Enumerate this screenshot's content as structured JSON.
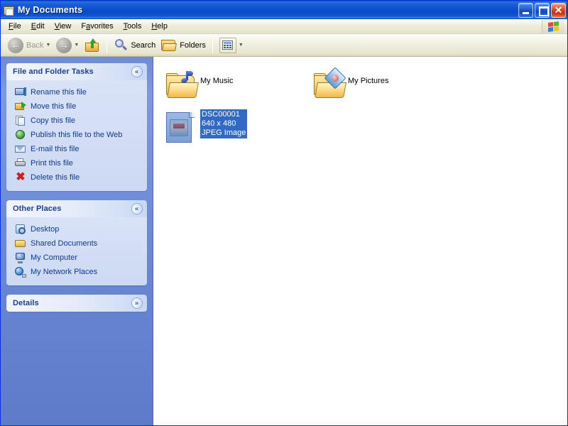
{
  "window": {
    "title": "My Documents",
    "title_icon": "documents-folder-icon",
    "minimize_label": "Minimize",
    "maximize_label": "Maximize",
    "close_label": "✕"
  },
  "menubar": {
    "items": [
      {
        "label": "File",
        "accel": "F"
      },
      {
        "label": "Edit",
        "accel": "E"
      },
      {
        "label": "View",
        "accel": "V"
      },
      {
        "label": "Favorites",
        "accel": "a"
      },
      {
        "label": "Tools",
        "accel": "T"
      },
      {
        "label": "Help",
        "accel": "H"
      }
    ],
    "brand_icon": "windows-flag-icon"
  },
  "toolbar": {
    "back_label": "Back",
    "back_icon": "arrow-left-icon",
    "back_disabled": true,
    "forward_icon": "arrow-right-icon",
    "up_icon": "folder-up-icon",
    "search_label": "Search",
    "search_icon": "magnifier-icon",
    "folders_label": "Folders",
    "folders_icon": "folder-icon",
    "views_icon": "views-grid-icon",
    "caret": "▼"
  },
  "sidebar": {
    "panels": [
      {
        "title": "File and Folder Tasks",
        "chevron": "«",
        "chevron_state": "collapse",
        "items": [
          {
            "label": "Rename this file",
            "icon": "rename-icon"
          },
          {
            "label": "Move this file",
            "icon": "move-icon"
          },
          {
            "label": "Copy this file",
            "icon": "copy-icon"
          },
          {
            "label": "Publish this file to the Web",
            "icon": "publish-web-icon"
          },
          {
            "label": "E-mail this file",
            "icon": "email-icon"
          },
          {
            "label": "Print this file",
            "icon": "print-icon"
          },
          {
            "label": "Delete this file",
            "icon": "delete-icon"
          }
        ]
      },
      {
        "title": "Other Places",
        "chevron": "«",
        "chevron_state": "collapse",
        "items": [
          {
            "label": "Desktop",
            "icon": "desktop-icon"
          },
          {
            "label": "Shared Documents",
            "icon": "shared-folder-icon"
          },
          {
            "label": "My Computer",
            "icon": "computer-icon"
          },
          {
            "label": "My Network Places",
            "icon": "network-icon"
          }
        ]
      },
      {
        "title": "Details",
        "chevron": "»",
        "chevron_state": "expand",
        "items": []
      }
    ]
  },
  "content": {
    "items": [
      {
        "name": "My Music",
        "type": "folder",
        "icon": "music-folder-icon",
        "selected": false,
        "lines": [
          "My Music"
        ]
      },
      {
        "name": "My Pictures",
        "type": "folder",
        "icon": "pictures-folder-icon",
        "selected": false,
        "lines": [
          "My Pictures"
        ]
      },
      {
        "name": "DSC00001",
        "type": "file",
        "icon": "jpeg-thumbnail-icon",
        "selected": true,
        "lines": [
          "DSC00001",
          "640 x 480",
          "JPEG Image"
        ]
      }
    ]
  },
  "colors": {
    "titlebar_blue": "#0a4ac7",
    "sidebar_blue": "#6c8ad6",
    "panel_header": "#e2eaf9",
    "panel_body": "#d9e2f7",
    "link_text": "#11398f",
    "selection_blue": "#316ac5",
    "close_red": "#c5300d"
  }
}
